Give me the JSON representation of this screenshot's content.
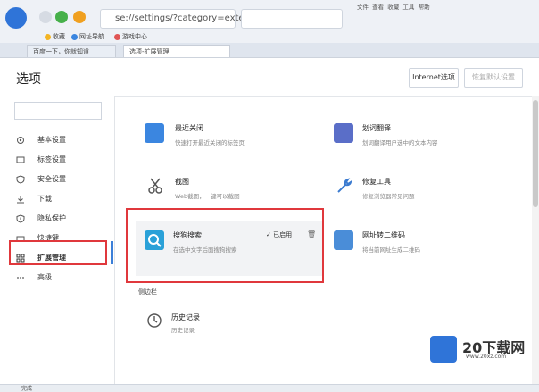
{
  "browser": {
    "url_text": "se://settings/?category=exte",
    "search_placeholder": "",
    "top_right_labels": [
      "文件",
      "查看",
      "收藏",
      "工具",
      "帮助"
    ],
    "bookmarks": [
      "收藏",
      "网址导航",
      "游戏中心"
    ],
    "tabs": [
      "百度一下，你就知道",
      "选项-扩展管理"
    ]
  },
  "header": {
    "title": "选项",
    "internet_options_label": "Internet选项",
    "restore_defaults_label": "恢复默认设置"
  },
  "sidebar": {
    "search_placeholder": "",
    "items": [
      {
        "label": "基本设置",
        "icon": "gear-icon"
      },
      {
        "label": "标签设置",
        "icon": "tab-icon"
      },
      {
        "label": "安全设置",
        "icon": "shield-icon"
      },
      {
        "label": "下载",
        "icon": "download-icon"
      },
      {
        "label": "隐私保护",
        "icon": "privacy-shield-icon"
      },
      {
        "label": "快捷键",
        "icon": "keyboard-icon"
      },
      {
        "label": "扩展管理",
        "icon": "grid-icon"
      },
      {
        "label": "高级",
        "icon": "more-icon"
      }
    ]
  },
  "extensions": {
    "top_note": "",
    "cards": [
      {
        "title": "最近关闭",
        "desc": "快速打开最近关闭的标签页",
        "icon": "note-icon",
        "color": "#3b86e0"
      },
      {
        "title": "划词翻译",
        "desc": "划词翻译用户选中的文本内容",
        "icon": "translate-icon",
        "color": "#5a6ec8"
      },
      {
        "title": "截图",
        "desc": "Web截图，一键可以截图",
        "icon": "scissors-icon",
        "color": "#666666"
      },
      {
        "title": "修复工具",
        "desc": "修复浏览器常见问题",
        "icon": "wrench-icon",
        "color": "#3b7bd0"
      },
      {
        "title": "搜狗搜索",
        "desc": "在选中文字后面搜狗搜索",
        "icon": "search-icon",
        "color": "#2aa1d8",
        "status": "已启用"
      },
      {
        "title": "网址转二维码",
        "desc": "将当前网址生成二维码",
        "icon": "qrcode-icon",
        "color": "#4a8dd8"
      }
    ],
    "sidebar_section_label": "侧边栏",
    "sidebar_cards": [
      {
        "title": "历史记录",
        "desc": "历史记录",
        "icon": "clock-icon"
      }
    ]
  },
  "status": {
    "text": "完成"
  },
  "watermark": {
    "brand": "20下载网",
    "url": "www.20xz.com"
  }
}
